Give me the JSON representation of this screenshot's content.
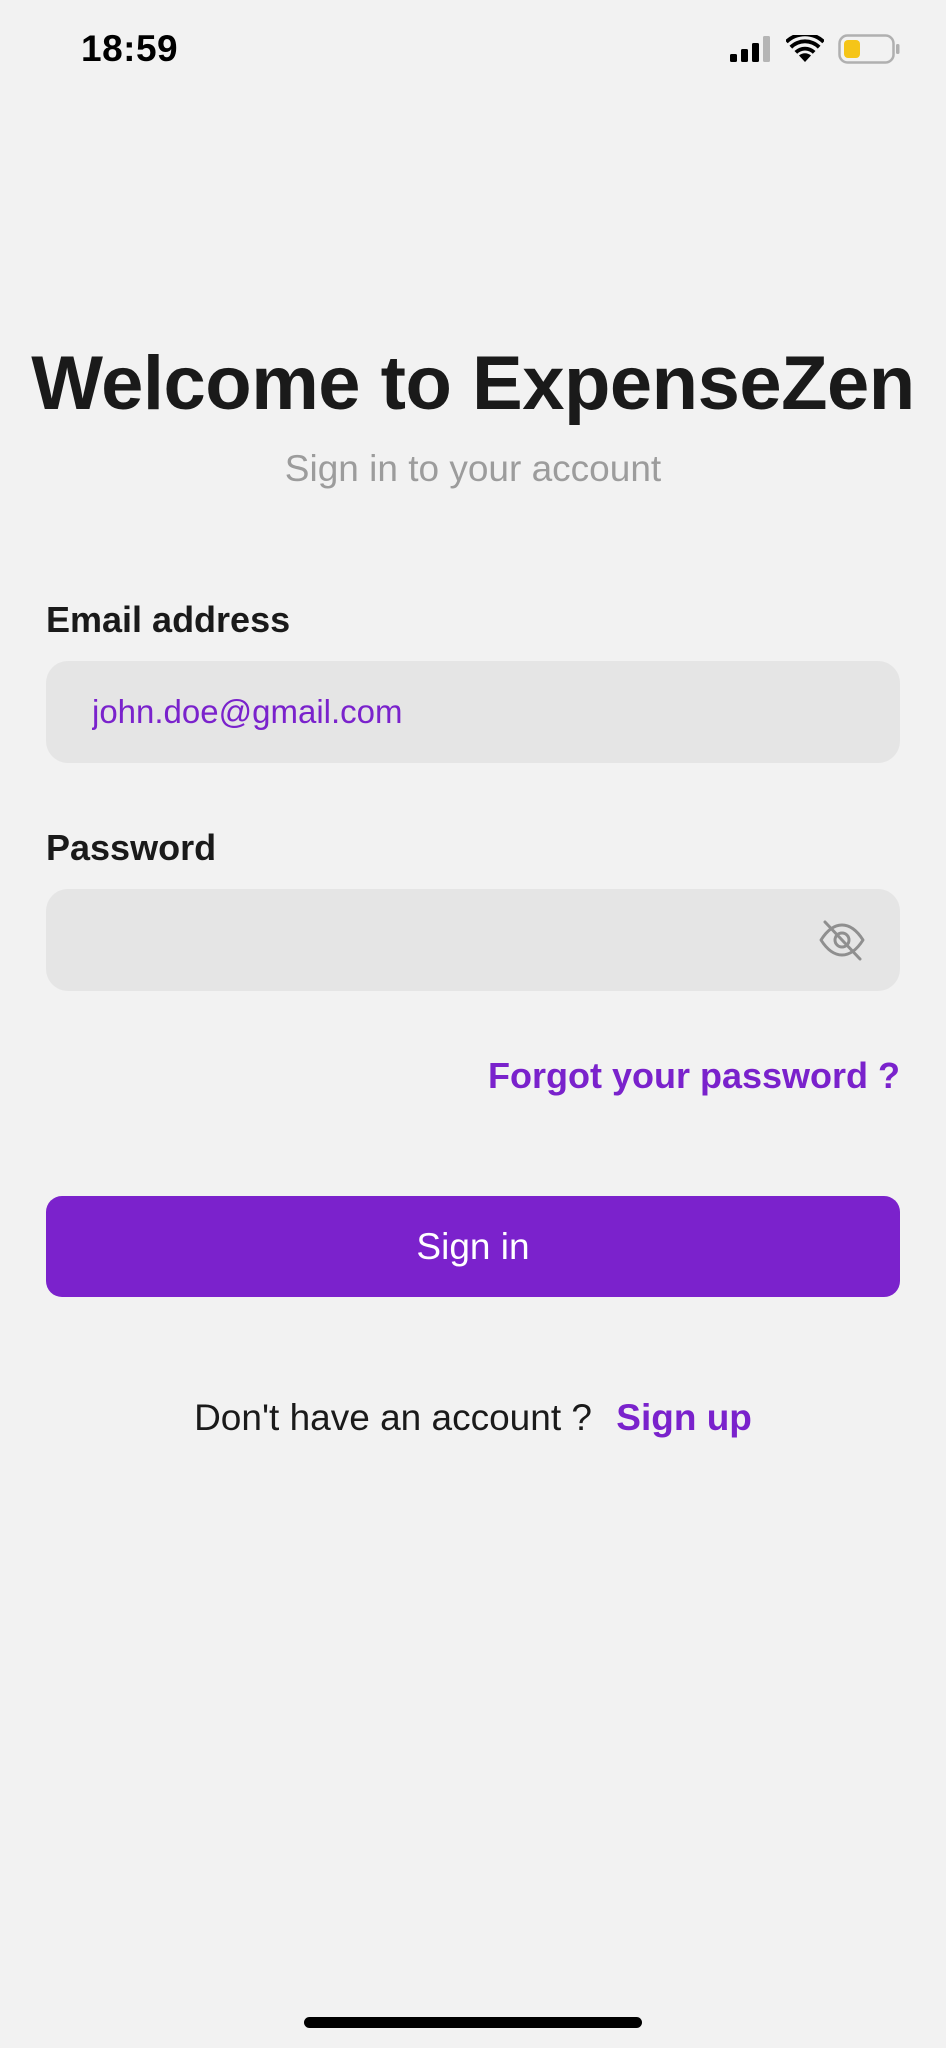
{
  "status_bar": {
    "time": "18:59",
    "icons": [
      "cellular-signal-icon",
      "wifi-icon",
      "battery-icon"
    ],
    "battery_color": "#f5c518"
  },
  "header": {
    "title": "Welcome to ExpenseZen",
    "subtitle": "Sign in to your account"
  },
  "form": {
    "email_label": "Email address",
    "email_value": "john.doe@gmail.com",
    "password_label": "Password",
    "password_value": "",
    "password_toggle_icon": "eye-off-icon",
    "forgot_password": "Forgot your password ?",
    "sign_in_label": "Sign in"
  },
  "footer": {
    "signup_prompt": "Don't have an account ?",
    "signup_link": "Sign up"
  },
  "colors": {
    "accent": "#7b22cc",
    "background": "#f2f2f2",
    "input_background": "#e5e5e5"
  }
}
